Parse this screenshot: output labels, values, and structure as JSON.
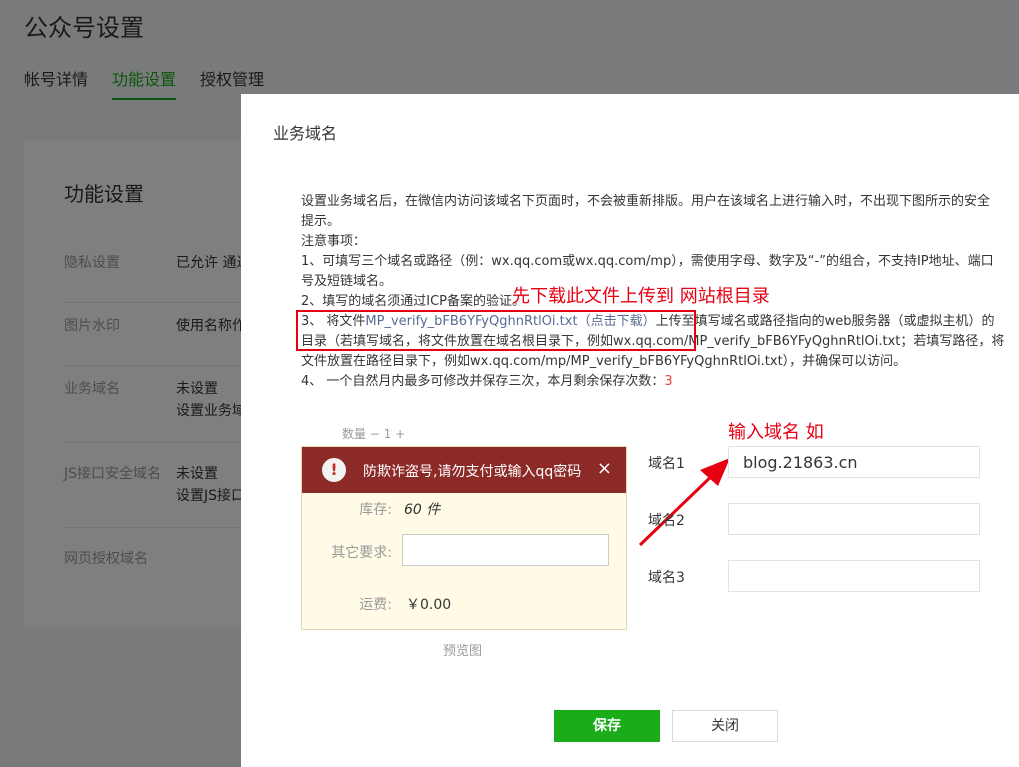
{
  "background": {
    "page_title": "公众号设置",
    "tabs": [
      "帐号详情",
      "功能设置",
      "授权管理"
    ],
    "card_title": "功能设置",
    "rows": [
      {
        "label": "隐私设置",
        "value": "已允许 通过"
      },
      {
        "label": "图片水印",
        "value": "使用名称作"
      },
      {
        "label": "业务域名",
        "value": "未设置",
        "value2": "设置业务域"
      },
      {
        "label": "JS接口安全域名",
        "value": "未设置",
        "value2": "设置JS接口"
      },
      {
        "label": "网页授权域名",
        "value": ""
      }
    ]
  },
  "dialog": {
    "title": "业务域名",
    "desc": {
      "line1": "设置业务域名后，在微信内访问该域名下页面时，不会被重新排版。用户在该域名上进行输入时，不出现下图所示的安全",
      "line2": "提示。",
      "line3": "注意事项：",
      "line4": "1、可填写三个域名或路径（例：wx.qq.com或wx.qq.com/mp），需使用字母、数字及“-”的组合，不支持IP地址、端口",
      "line5": "号及短链域名。",
      "line6": "2、填写的域名须通过ICP备案的验证。",
      "line7_prefix": "3、 将文件",
      "line7_file": "MP_verify_bFB6YFyQghnRtlOi.txt",
      "line7_download": "（点击下载）",
      "line7_suffix": "上传至填写域名或路径指向的web服务器（或虚拟主机）的",
      "line8": "目录（若填写域名，将文件放置在域名根目录下，例如wx.qq.com/MP_verify_bFB6YFyQghnRtlOi.txt；若填写路径，将",
      "line9": "文件放置在路径目录下，例如wx.qq.com/mp/MP_verify_bFB6YFyQghnRtlOi.txt），并确保可以访问。",
      "line10_prefix": "4、 一个自然月内最多可修改并保存三次，本月剩余保存次数：",
      "line10_count": "3"
    },
    "annotations": {
      "note1": "先下载此文件上传到 网站根目录",
      "note2": "输入域名 如"
    },
    "preview": {
      "faint_row": "数量   −   1   +",
      "warning": "防欺诈盗号,请勿支付或输入qq密码",
      "warning_close": "×",
      "warning_icon": "!",
      "stock_label": "库存:",
      "stock_value": "60 件",
      "other_label": "其它要求:",
      "shipping_label": "运费:",
      "shipping_value": "￥0.00",
      "caption": "预览图"
    },
    "domains": [
      {
        "label": "域名1",
        "value": "blog.21863.cn",
        "placeholder": ""
      },
      {
        "label": "域名2",
        "value": "",
        "placeholder": ""
      },
      {
        "label": "域名3",
        "value": "",
        "placeholder": ""
      }
    ],
    "buttons": {
      "save": "保存",
      "close": "关闭"
    },
    "colors": {
      "accent": "#1aad19",
      "link": "#576b95",
      "annotation": "#e60012",
      "warning_bar": "#8c2a27"
    }
  }
}
